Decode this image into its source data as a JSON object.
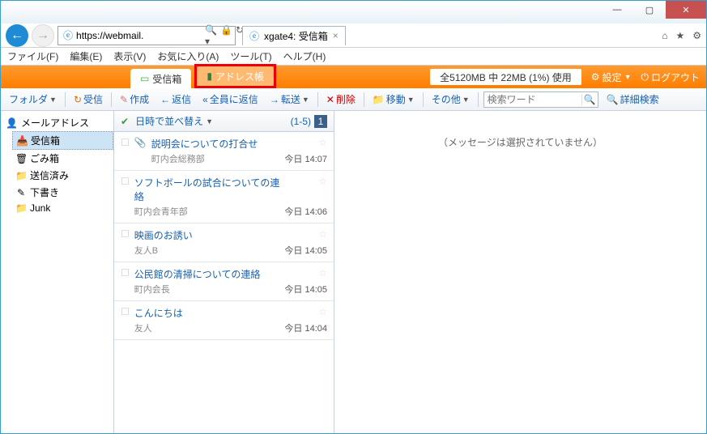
{
  "browser": {
    "url": "https://webmail.",
    "tab_title": "xgate4: 受信箱"
  },
  "menubar": {
    "file": "ファイル(F)",
    "edit": "編集(E)",
    "view": "表示(V)",
    "favorites": "お気に入り(A)",
    "tools": "ツール(T)",
    "help": "ヘルプ(H)"
  },
  "header": {
    "tab_inbox": "受信箱",
    "tab_address": "アドレス帳",
    "storage": "全5120MB 中 22MB (1%) 使用",
    "settings": "設定",
    "logout": "ログアウト"
  },
  "toolbar": {
    "folder": "フォルダ",
    "receive": "受信",
    "compose": "作成",
    "reply": "返信",
    "reply_all": "全員に返信",
    "forward": "転送",
    "delete": "削除",
    "move": "移動",
    "other": "その他",
    "search_placeholder": "検索ワード",
    "adv_search": "詳細検索"
  },
  "sidebar": {
    "title": "メールアドレス",
    "items": [
      {
        "label": "受信箱",
        "ico": "📥",
        "sel": true
      },
      {
        "label": "ごみ箱",
        "ico": "🗑"
      },
      {
        "label": "送信済み",
        "ico": "📁"
      },
      {
        "label": "下書き",
        "ico": "✎"
      },
      {
        "label": "Junk",
        "ico": "📁"
      }
    ]
  },
  "list": {
    "sort_label": "日時で並べ替え",
    "range": "(1-5)",
    "page": "1",
    "messages": [
      {
        "subject": "説明会についての打合せ",
        "from": "町内会総務部",
        "time": "今日 14:07",
        "attach": true
      },
      {
        "subject": "ソフトボールの試合についての連絡",
        "from": "町内会青年部",
        "time": "今日 14:06"
      },
      {
        "subject": "映画のお誘い",
        "from": "友人B",
        "time": "今日 14:05"
      },
      {
        "subject": "公民館の清掃についての連絡",
        "from": "町内会長",
        "time": "今日 14:05"
      },
      {
        "subject": "こんにちは",
        "from": "友人",
        "time": "今日 14:04"
      }
    ]
  },
  "preview": {
    "empty": "（メッセージは選択されていません）"
  }
}
